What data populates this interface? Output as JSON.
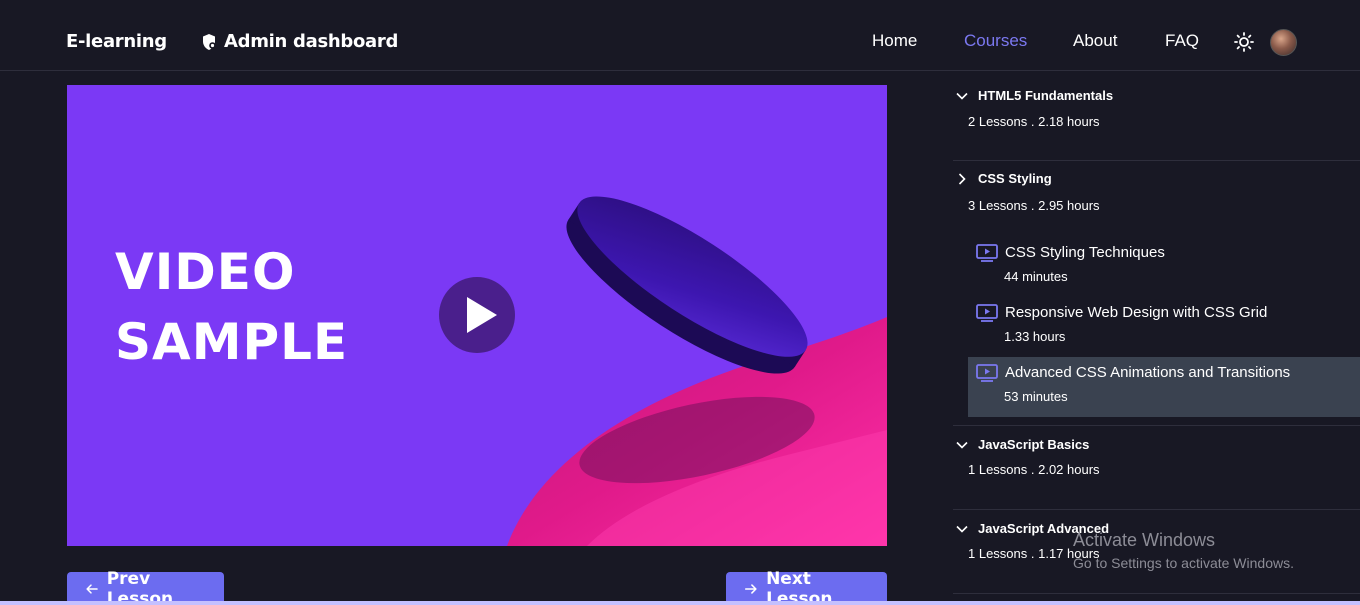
{
  "header": {
    "brand": "E-learning",
    "admin_label": "Admin dashboard",
    "nav": {
      "home": "Home",
      "courses": "Courses",
      "about": "About",
      "faq": "FAQ"
    },
    "active_nav": "courses"
  },
  "video": {
    "title_line1": "VIDEO",
    "title_line2": "SAMPLE",
    "background_color": "#7b39f5"
  },
  "controls": {
    "prev_label": "Prev Lesson",
    "next_label": "Next Lesson"
  },
  "sections": [
    {
      "title": "HTML5 Fundamentals",
      "meta": "2 Lessons . 2.18 hours",
      "expanded": false
    },
    {
      "title": "CSS Styling",
      "meta": "3 Lessons . 2.95 hours",
      "expanded": true,
      "lessons": [
        {
          "title": "CSS Styling Techniques",
          "duration": "44 minutes",
          "active": false
        },
        {
          "title": "Responsive Web Design with CSS Grid",
          "duration": "1.33 hours",
          "active": false
        },
        {
          "title": "Advanced CSS Animations and Transitions",
          "duration": "53 minutes",
          "active": true
        }
      ]
    },
    {
      "title": "JavaScript Basics",
      "meta": "1 Lessons . 2.02 hours",
      "expanded": false
    },
    {
      "title": "JavaScript Advanced",
      "meta": "1 Lessons . 1.17 hours",
      "expanded": false
    }
  ],
  "watermark": {
    "line1": "Activate Windows",
    "line2": "Go to Settings to activate Windows."
  },
  "colors": {
    "accent": "#6c6cf0",
    "nav_active": "#7b78f0",
    "active_row": "#3a4250",
    "lesson_icon": "#7b78f0"
  }
}
